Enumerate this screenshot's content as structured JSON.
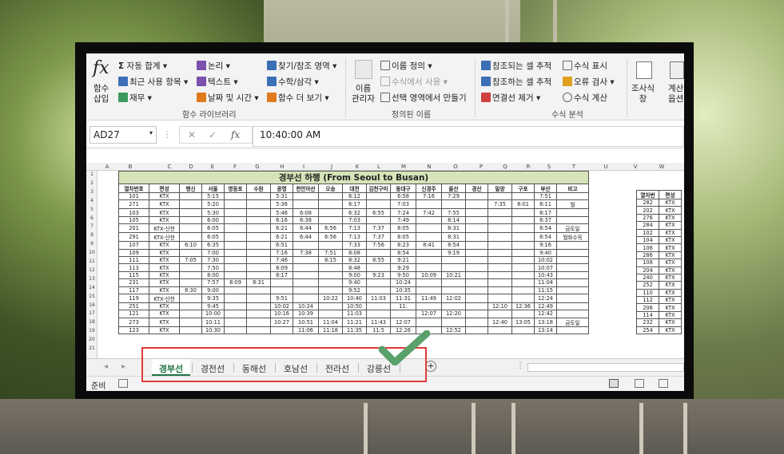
{
  "ribbon": {
    "insert_function": "함수\n삽입",
    "autosum": "자동 합계",
    "recent": "최근 사용 항목",
    "financial": "재무",
    "logical": "논리",
    "text": "텍스트",
    "datetime": "날짜 및 시간",
    "lookup": "찾기/참조 영역",
    "math": "수학/삼각",
    "more": "함수 더 보기",
    "group1": "함수 라이브러리",
    "name_manager": "이름\n관리자",
    "define_name": "이름 정의",
    "use_in_formula": "수식에서 사용",
    "create_from_sel": "선택 영역에서 만들기",
    "group2": "정의된 이름",
    "trace_prec": "참조되는 셀 추적",
    "trace_dep": "참조하는 셀 추적",
    "remove_arrows": "연결선 제거",
    "show_formulas": "수식 표시",
    "error_check": "오류 검사",
    "evaluate": "수식 계산",
    "group3": "수식 분석",
    "watch": "조사식\n창",
    "calc_options": "계산\n옵션"
  },
  "formula_bar": {
    "name_box": "AD27",
    "fx": "fx",
    "value": "10:40:00 AM"
  },
  "columns": [
    "A",
    "B",
    "C",
    "D",
    "E",
    "F",
    "G",
    "H",
    "I",
    "J",
    "K",
    "L",
    "M",
    "N",
    "O",
    "P",
    "Q",
    "R",
    "S",
    "T",
    "U",
    "V",
    "W"
  ],
  "sheet_title": "경부선 하행 (From Seoul to Busan)",
  "headers": [
    "열차번호",
    "편성",
    "행신",
    "서울",
    "영등포",
    "수원",
    "광명",
    "천안아산",
    "오송",
    "대전",
    "김천구미",
    "동대구",
    "신경주",
    "울산",
    "경산",
    "밀양",
    "구포",
    "부산",
    "비고"
  ],
  "rows": [
    [
      "101",
      "KTX",
      "",
      "5:15",
      "",
      "",
      "5:31",
      "",
      "",
      "6:12",
      "",
      "6:58",
      "7:16",
      "7:29",
      "",
      "",
      "",
      "7:51",
      ""
    ],
    [
      "271",
      "KTX",
      "",
      "5:20",
      "",
      "",
      "5:36",
      "",
      "",
      "6:17",
      "",
      "7:03",
      "",
      "",
      "",
      "7:35",
      "8:01",
      "8:11",
      "월"
    ],
    [
      "103",
      "KTX",
      "",
      "5:30",
      "",
      "",
      "5:46",
      "6:08",
      "",
      "6:32",
      "6:55",
      "7:24",
      "7:42",
      "7:55",
      "",
      "",
      "",
      "8:17",
      ""
    ],
    [
      "105",
      "KTX",
      "",
      "6:00",
      "",
      "",
      "6:16",
      "6:38",
      "",
      "7:03",
      "",
      "7:49",
      "",
      "8:14",
      "",
      "",
      "",
      "8:37",
      ""
    ],
    [
      "201",
      "KTX-산천",
      "",
      "6:05",
      "",
      "",
      "6:21",
      "6:44",
      "6:56",
      "7:13",
      "7:37",
      "8:05",
      "",
      "8:31",
      "",
      "",
      "",
      "8:54",
      "금토일"
    ],
    [
      "291",
      "KTX-산천",
      "",
      "6:05",
      "",
      "",
      "6:21",
      "6:44",
      "6:56",
      "7:13",
      "7:37",
      "8:05",
      "",
      "8:31",
      "",
      "",
      "",
      "8:54",
      "월화수목"
    ],
    [
      "107",
      "KTX",
      "6:10",
      "6:35",
      "",
      "",
      "6:51",
      "",
      "",
      "7:33",
      "7:56",
      "8:23",
      "8:41",
      "8:54",
      "",
      "",
      "",
      "9:16",
      ""
    ],
    [
      "109",
      "KTX",
      "",
      "7:00",
      "",
      "",
      "7:16",
      "7:38",
      "7:51",
      "8:08",
      "",
      "8:54",
      "",
      "9:19",
      "",
      "",
      "",
      "9:40",
      ""
    ],
    [
      "111",
      "KTX",
      "7:05",
      "7:30",
      "",
      "",
      "7:46",
      "",
      "8:15",
      "8:32",
      "8:55",
      "9:21",
      "",
      "",
      "",
      "",
      "",
      "10:02",
      ""
    ],
    [
      "113",
      "KTX",
      "",
      "7:50",
      "",
      "",
      "8:09",
      "",
      "",
      "8:48",
      "",
      "9:29",
      "",
      "",
      "",
      "",
      "",
      "10:07",
      ""
    ],
    [
      "115",
      "KTX",
      "",
      "8:00",
      "",
      "",
      "8:17",
      "",
      "",
      "9:00",
      "9:23",
      "9:50",
      "10:09",
      "10:21",
      "",
      "",
      "",
      "10:43",
      ""
    ],
    [
      "231",
      "KTX",
      "",
      "7:57",
      "8:09",
      "8:31",
      "",
      "",
      "",
      "9:40",
      "",
      "10:24",
      "",
      "",
      "",
      "",
      "",
      "11:04",
      ""
    ],
    [
      "117",
      "KTX",
      "8:30",
      "9:00",
      "",
      "",
      "",
      "",
      "",
      "9:52",
      "",
      "10:35",
      "",
      "",
      "",
      "",
      "",
      "11:15",
      ""
    ],
    [
      "119",
      "KTX-산천",
      "",
      "9:35",
      "",
      "",
      "9:51",
      "",
      "10:22",
      "10:40",
      "11:03",
      "11:31",
      "11:49",
      "12:02",
      "",
      "",
      "",
      "12:24",
      ""
    ],
    [
      "251",
      "KTX",
      "",
      "9:45",
      "",
      "",
      "10:02",
      "10:24",
      "",
      "10:50",
      "",
      "11:",
      "",
      "",
      "",
      "12:10",
      "12:36",
      "12:49",
      ""
    ],
    [
      "121",
      "KTX",
      "",
      "10:00",
      "",
      "",
      "10:16",
      "10:39",
      "",
      "11:03",
      "",
      "",
      "12:07",
      "12:20",
      "",
      "",
      "",
      "12:42",
      ""
    ],
    [
      "273",
      "KTX",
      "",
      "10:11",
      "",
      "",
      "10:27",
      "10:51",
      "11:04",
      "11:21",
      "11:43",
      "12:07",
      "",
      "",
      "",
      "12:40",
      "13:05",
      "13:18",
      "금토일"
    ],
    [
      "123",
      "KTX",
      "",
      "10:30",
      "",
      "",
      "",
      "11:06",
      "11:18",
      "11:35",
      "11:5",
      "12:26",
      "",
      "12:52",
      "",
      "",
      "",
      "13:14",
      ""
    ]
  ],
  "side_header": [
    "열차번",
    "편성"
  ],
  "side_rows": [
    [
      "282",
      "KTX"
    ],
    [
      "202",
      "KTX"
    ],
    [
      "276",
      "KTX"
    ],
    [
      "284",
      "KTX"
    ],
    [
      "102",
      "KTX"
    ],
    [
      "104",
      "KTX"
    ],
    [
      "106",
      "KTX"
    ],
    [
      "286",
      "KTX"
    ],
    [
      "108",
      "KTX"
    ],
    [
      "204",
      "KTX"
    ],
    [
      "240",
      "KTX"
    ],
    [
      "252",
      "KTX"
    ],
    [
      "110",
      "KTX"
    ],
    [
      "112",
      "KTX"
    ],
    [
      "206",
      "KTX"
    ],
    [
      "114",
      "KTX"
    ],
    [
      "232",
      "KTX"
    ],
    [
      "254",
      "KTX"
    ]
  ],
  "tabs": [
    "경부선",
    "경전선",
    "동해선",
    "호남선",
    "전라선",
    "강릉선"
  ],
  "status": {
    "ready": "준비"
  },
  "colors": {
    "accent": "#217346",
    "highlight": "#e23a3a",
    "check": "#5aa06b"
  }
}
